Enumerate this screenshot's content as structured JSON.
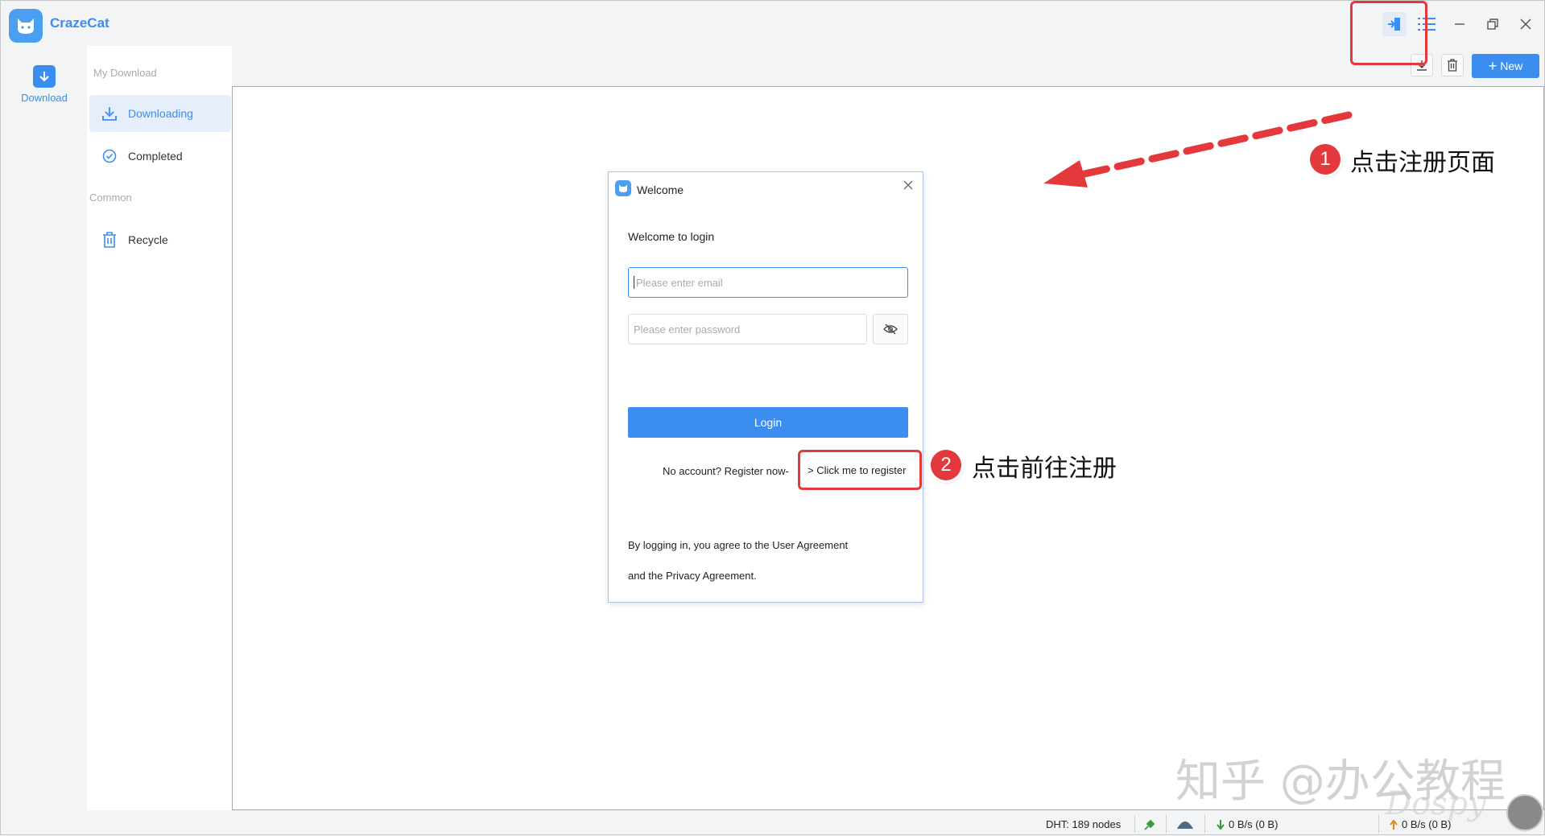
{
  "app": {
    "title": "CrazeCat"
  },
  "rail": {
    "download_label": "Download"
  },
  "nav": {
    "section_my_download": "My Download",
    "items": [
      {
        "label": "Downloading",
        "active": true,
        "icon": "download-tray-icon"
      },
      {
        "label": "Completed",
        "active": false,
        "icon": "check-circle-icon"
      }
    ],
    "section_common": "Common",
    "recycle_label": "Recycle"
  },
  "toolbar": {
    "new_label": "New"
  },
  "dialog": {
    "title": "Welcome",
    "heading": "Welcome to login",
    "email_placeholder": "Please enter email",
    "password_placeholder": "Please enter password",
    "login_label": "Login",
    "register_prompt": "No account? Register now-",
    "register_link": "> Click me to register",
    "agreement_line1": "By logging in, you agree to the User Agreement",
    "agreement_line2": "and the Privacy Agreement."
  },
  "status": {
    "dht": "DHT: 189 nodes",
    "download_speed": "0 B/s (0 B)",
    "upload_speed": "0 B/s (0 B)"
  },
  "annotations": {
    "step1_number": "1",
    "step1_text": "点击注册页面",
    "step2_number": "2",
    "step2_text": "点击前往注册",
    "watermark": "知乎 @办公教程",
    "watermark2": "Dospy"
  },
  "colors": {
    "accent": "#3b8df0",
    "annotation_red": "#e4393c"
  }
}
